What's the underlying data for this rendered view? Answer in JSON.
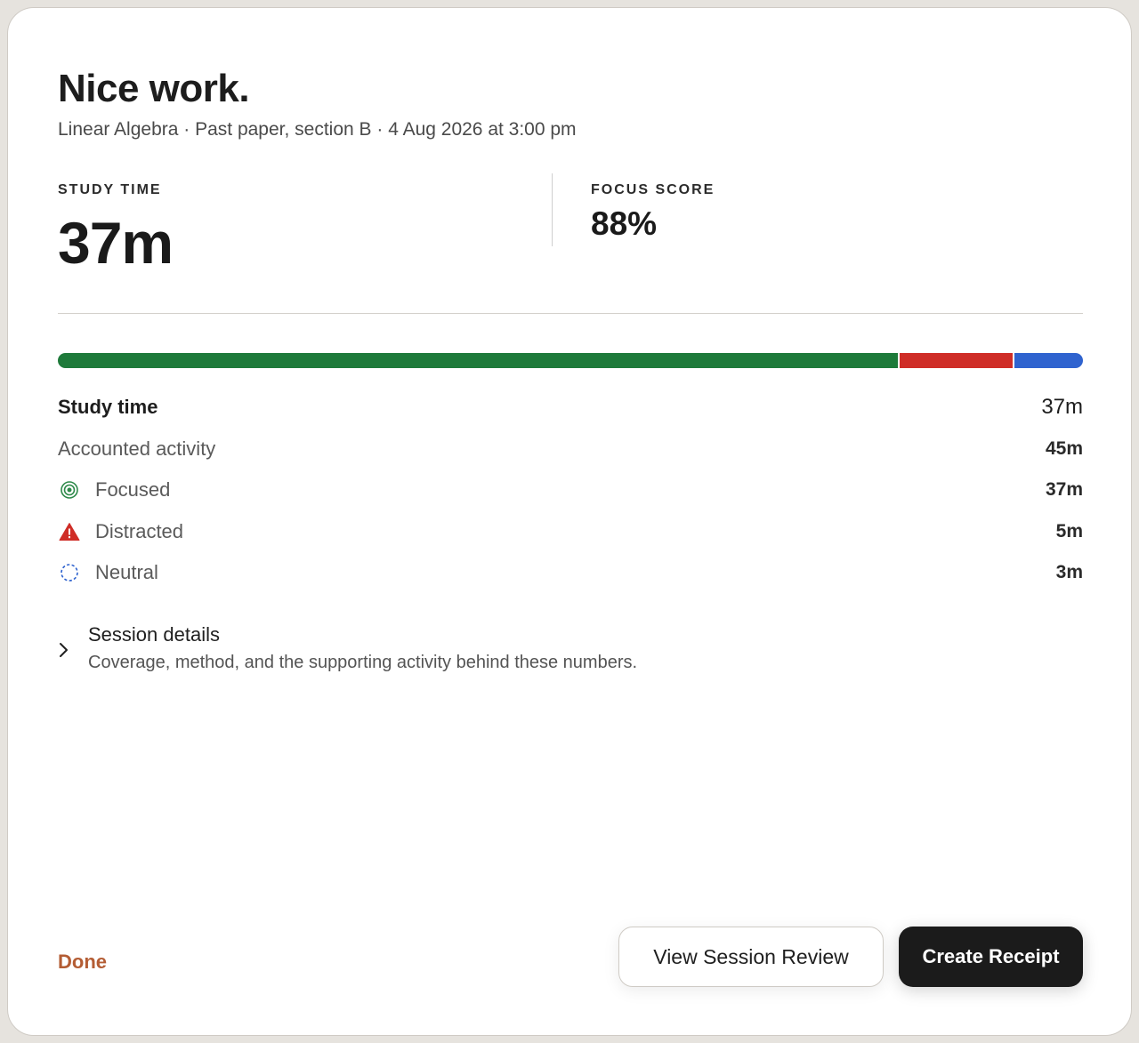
{
  "header": {
    "title": "Nice work.",
    "subtitle": "Linear Algebra · Past paper, section B · 4 Aug 2026 at 3:00 pm"
  },
  "stats": {
    "study_time": {
      "label": "STUDY TIME",
      "value": "37m"
    },
    "focus_score": {
      "label": "FOCUS SCORE",
      "value": "88%"
    }
  },
  "progress_bar": {
    "segments": [
      {
        "name": "focused",
        "minutes": 37,
        "color": "#1e7a3a"
      },
      {
        "name": "distracted",
        "minutes": 5,
        "color": "#cf2d27"
      },
      {
        "name": "neutral",
        "minutes": 3,
        "color": "#2f63cf"
      }
    ]
  },
  "breakdown": {
    "study_time": {
      "label": "Study time",
      "value": "37m"
    },
    "accounted": {
      "label": "Accounted activity",
      "value": "45m"
    },
    "focused": {
      "label": "Focused",
      "value": "37m",
      "icon": "target-icon",
      "color": "#2e8a4a"
    },
    "distracted": {
      "label": "Distracted",
      "value": "5m",
      "icon": "warning-triangle-icon",
      "color": "#cf2d27"
    },
    "neutral": {
      "label": "Neutral",
      "value": "3m",
      "icon": "dashed-circle-icon",
      "color": "#2f63cf"
    }
  },
  "session_details": {
    "title": "Session details",
    "description": "Coverage, method, and the supporting activity behind these numbers.",
    "icon": "chevron-right-icon"
  },
  "footer": {
    "done_label": "Done",
    "review_label": "View Session Review",
    "receipt_label": "Create Receipt",
    "done_color": "#b45d34"
  }
}
